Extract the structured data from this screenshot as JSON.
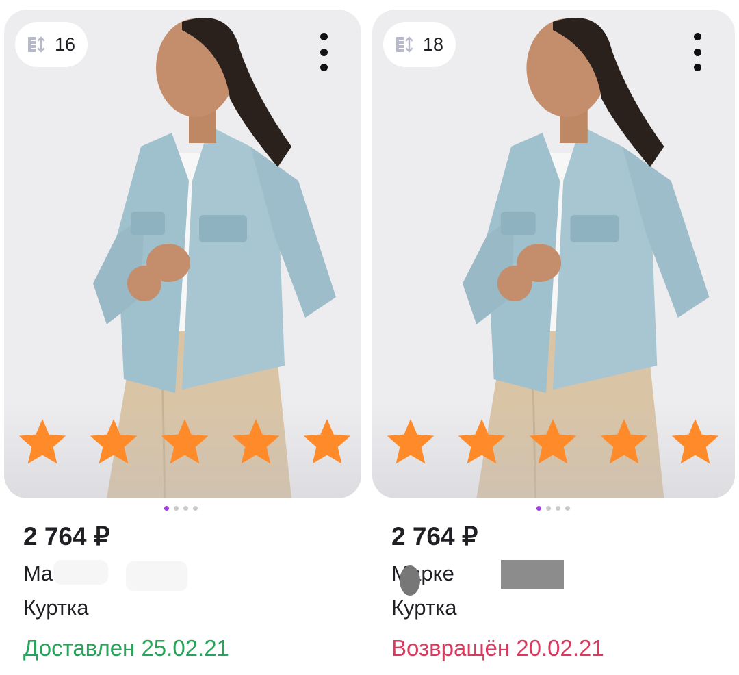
{
  "colors": {
    "accent_star": "#ff8a2a",
    "dot_active": "#a13ddf",
    "status_delivered": "#28a35a",
    "status_returned": "#d93a5e"
  },
  "products": [
    {
      "size": "16",
      "price": "2 764 ₽",
      "brand_visible": "Ma              er",
      "type": "Куртка",
      "status": "Доставлен 25.02.21",
      "rating": 5,
      "image_indicator": {
        "count": 4,
        "active": 1
      }
    },
    {
      "size": "18",
      "price": "2 764 ₽",
      "brand_visible": "Марке",
      "type": "Куртка",
      "status": "Возвращён 20.02.21",
      "rating": 5,
      "image_indicator": {
        "count": 4,
        "active": 1
      }
    }
  ],
  "icons": {
    "size": "size-ruler-icon",
    "menu": "more-vertical-icon",
    "star": "star-icon"
  }
}
